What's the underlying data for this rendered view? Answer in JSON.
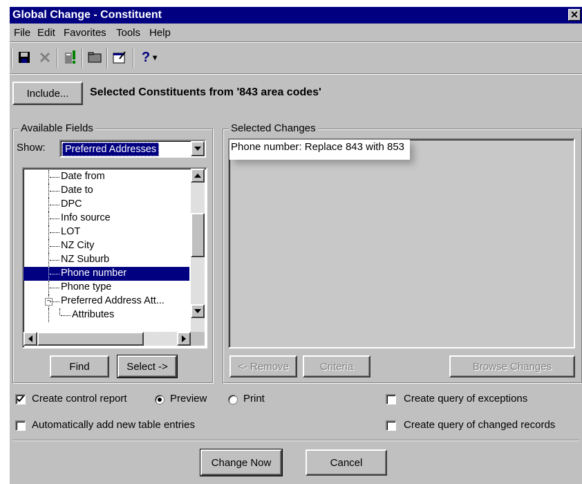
{
  "window": {
    "title": "Global Change - Constituent",
    "close_glyph": "✕"
  },
  "menu": {
    "file": "File",
    "edit": "Edit",
    "favorites": "Favorites",
    "tools": "Tools",
    "help": "Help"
  },
  "toolbar": {
    "help_glyph": "?"
  },
  "include": {
    "button_label": "Include...",
    "description": "Selected Constituents from '843 area codes'"
  },
  "available_fields": {
    "group_label": "Available Fields",
    "show_label": "Show:",
    "show_value": "Preferred Addresses",
    "items": [
      {
        "label": "Date from",
        "selected": false
      },
      {
        "label": "Date to",
        "selected": false
      },
      {
        "label": "DPC",
        "selected": false
      },
      {
        "label": "Info source",
        "selected": false
      },
      {
        "label": "LOT",
        "selected": false
      },
      {
        "label": "NZ City",
        "selected": false
      },
      {
        "label": "NZ Suburb",
        "selected": false
      },
      {
        "label": "Phone number",
        "selected": true
      },
      {
        "label": "Phone type",
        "selected": false
      },
      {
        "label": "Preferred Address Att...",
        "selected": false,
        "expander": "−"
      },
      {
        "label": "Attributes",
        "selected": false
      }
    ],
    "find_label": "Find",
    "select_label": "Select ->"
  },
  "selected_changes": {
    "group_label": "Selected Changes",
    "items": [
      "Phone number:  Replace 843 with 853"
    ],
    "remove_label": "<- Remove",
    "criteria_label": "Criteria",
    "browse_label": "Browse Changes"
  },
  "options": {
    "create_control_report": {
      "label": "Create control report",
      "checked": true
    },
    "preview": {
      "label": "Preview",
      "selected": true
    },
    "print": {
      "label": "Print",
      "selected": false
    },
    "auto_add_entries": {
      "label": "Automatically add new table entries",
      "checked": false
    },
    "query_exceptions": {
      "label": "Create query of exceptions",
      "checked": false
    },
    "query_changed": {
      "label": "Create query of changed records",
      "checked": false
    }
  },
  "footer": {
    "change_now_label": "Change Now",
    "cancel_label": "Cancel"
  },
  "colors": {
    "face": "#c0c0c0",
    "title": "#000080",
    "selection": "#000080"
  }
}
